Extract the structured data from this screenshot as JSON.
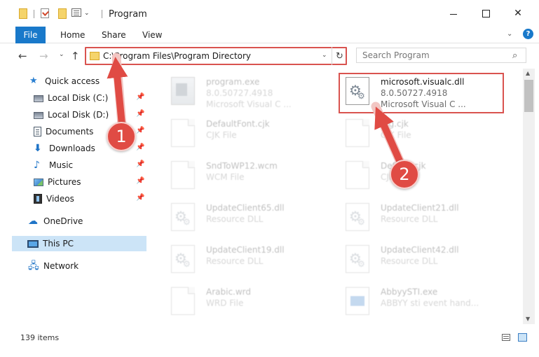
{
  "window": {
    "title": "Program",
    "close_glyph": "✕"
  },
  "ribbon": {
    "tabs": [
      "File",
      "Home",
      "Share",
      "View"
    ],
    "help_glyph": "?",
    "expand_glyph": "⌄"
  },
  "nav": {
    "back_glyph": "←",
    "forward_glyph": "→",
    "recent_glyph": "⌄",
    "up_glyph": "↑"
  },
  "address": {
    "path": "C:\\Program Files\\Program Directory",
    "dropdown_glyph": "⌄",
    "refresh_glyph": "↻"
  },
  "search": {
    "placeholder": "Search Program",
    "icon_glyph": "⌕"
  },
  "sidebar": {
    "items": [
      {
        "label": "Quick access",
        "icon": "star-icon",
        "glyph": "★",
        "pinned": false
      },
      {
        "label": "Local Disk (C:)",
        "icon": "drive-icon",
        "glyph": "",
        "pinned": true
      },
      {
        "label": "Local Disk (D:)",
        "icon": "drive-icon",
        "glyph": "",
        "pinned": true
      },
      {
        "label": "Documents",
        "icon": "document-icon",
        "glyph": "",
        "pinned": true
      },
      {
        "label": "Downloads",
        "icon": "download-icon",
        "glyph": "⬇",
        "pinned": true
      },
      {
        "label": "Music",
        "icon": "music-icon",
        "glyph": "♪",
        "pinned": true
      },
      {
        "label": "Pictures",
        "icon": "pictures-icon",
        "glyph": "",
        "pinned": true
      },
      {
        "label": "Videos",
        "icon": "videos-icon",
        "glyph": "",
        "pinned": true
      },
      {
        "label": "OneDrive",
        "icon": "cloud-icon",
        "glyph": "☁",
        "pinned": false
      },
      {
        "label": "This PC",
        "icon": "computer-icon",
        "glyph": "",
        "pinned": false,
        "selected": true
      },
      {
        "label": "Network",
        "icon": "network-icon",
        "glyph": "🖧",
        "pinned": false
      }
    ],
    "pin_glyph": "📌"
  },
  "files": [
    {
      "name": "program.exe",
      "line1": "8.0.50727.4918",
      "line2": "Microsoft Visual C ...",
      "icon": "exe",
      "highlighted": false
    },
    {
      "name": "microsoft.visualc.dll",
      "line1": "8.0.50727.4918",
      "line2": "Microsoft Visual C ...",
      "icon": "gear",
      "highlighted": true
    },
    {
      "name": "DefaultFont.cjk",
      "line1": "CJK File",
      "line2": "",
      "icon": "page",
      "highlighted": false
    },
    {
      "name": "Big.cjk",
      "line1": "CJK File",
      "line2": "",
      "icon": "page",
      "highlighted": false
    },
    {
      "name": "SndToWP12.wcm",
      "line1": "WCM File",
      "line2": "",
      "icon": "page",
      "highlighted": false
    },
    {
      "name": "Default.cjk",
      "line1": "CJK File",
      "line2": "",
      "icon": "page",
      "highlighted": false
    },
    {
      "name": "UpdateClient65.dll",
      "line1": "Resource DLL",
      "line2": "",
      "icon": "gear",
      "highlighted": false
    },
    {
      "name": "UpdateClient21.dll",
      "line1": "Resource DLL",
      "line2": "",
      "icon": "gear",
      "highlighted": false
    },
    {
      "name": "UpdateClient19.dll",
      "line1": "Resource DLL",
      "line2": "",
      "icon": "gear",
      "highlighted": false
    },
    {
      "name": "UpdateClient42.dll",
      "line1": "Resource DLL",
      "line2": "",
      "icon": "gear",
      "highlighted": false
    },
    {
      "name": "Arabic.wrd",
      "line1": "WRD File",
      "line2": "",
      "icon": "page",
      "highlighted": false
    },
    {
      "name": "AbbyySTI.exe",
      "line1": "ABBYY sti event hand...",
      "line2": "",
      "icon": "abbyy",
      "highlighted": false
    }
  ],
  "scrollbar": {
    "up_glyph": "▲",
    "down_glyph": "▼",
    "position": 0.05
  },
  "status": {
    "item_count": "139 items"
  },
  "annotations": {
    "step1": "1",
    "step2": "2",
    "color": "#e04b44"
  }
}
